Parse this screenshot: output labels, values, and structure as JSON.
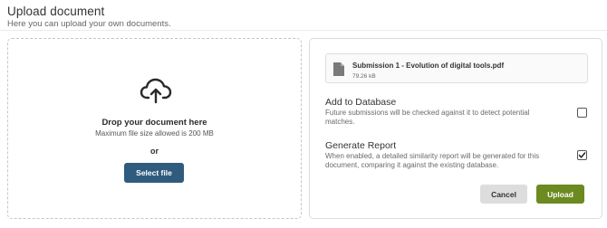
{
  "header": {
    "title": "Upload document",
    "subtitle": "Here you can upload your own documents."
  },
  "dropzone": {
    "icon": "cloud-upload-icon",
    "title": "Drop your document here",
    "hint": "Maximum file size allowed is 200 MB",
    "or": "or",
    "select_label": "Select file"
  },
  "file": {
    "icon": "file-icon",
    "name": "Submission 1 - Evolution of digital tools.pdf",
    "size": "79.26 kB"
  },
  "options": [
    {
      "title": "Add to Database",
      "desc_lines": [
        "Future submissions will be checked against it to detect potential",
        "matches."
      ],
      "checked": false
    },
    {
      "title": "Generate Report",
      "desc_lines": [
        "When enabled, a detailed similarity report will be generated for this",
        "document, comparing it against the existing database."
      ],
      "checked": true
    }
  ],
  "actions": {
    "cancel_label": "Cancel",
    "upload_label": "Upload"
  },
  "colors": {
    "primary": "#2f5b7f",
    "upload": "#6b8a1f",
    "cancel": "#dddddd"
  }
}
